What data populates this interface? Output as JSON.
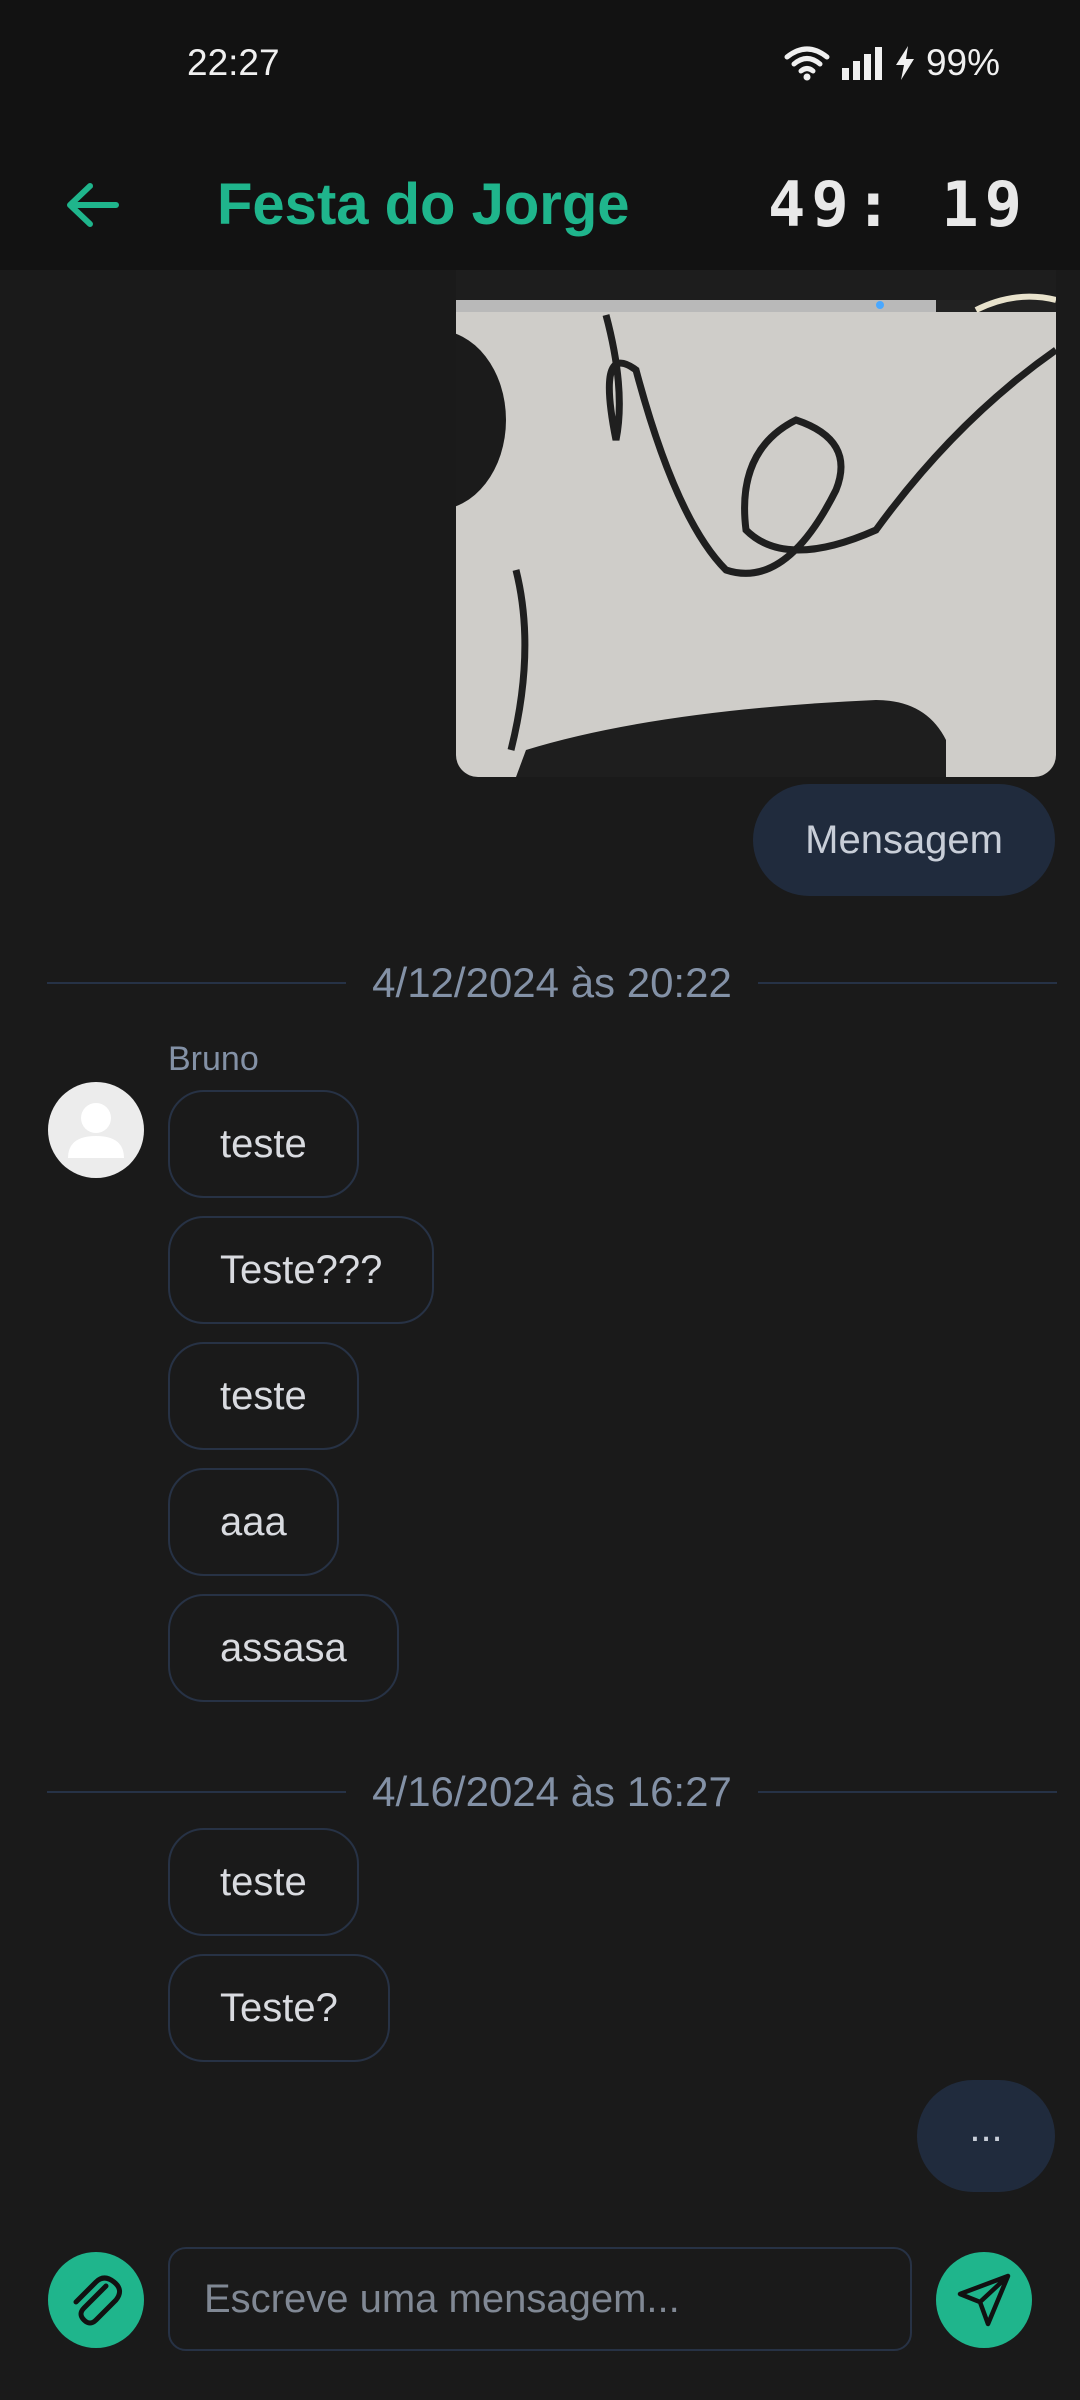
{
  "status_bar": {
    "time": "22:27",
    "battery": "99%"
  },
  "header": {
    "title": "Festa do Jorge",
    "timer": "49: 19",
    "accent_color": "#1fb58c"
  },
  "messages": {
    "own_message": "Mensagem",
    "dividers": [
      "4/12/2024 às 20:22",
      "4/16/2024 às 16:27"
    ],
    "sender": "Bruno",
    "group1": [
      "teste",
      "Teste???",
      "teste",
      "aaa",
      "assasa"
    ],
    "group2": [
      "teste",
      "Teste?"
    ],
    "typing": "..."
  },
  "composer": {
    "placeholder": "Escreve uma mensagem..."
  },
  "icons": [
    "wifi-icon",
    "signal-icon",
    "charging-icon",
    "back-arrow-icon",
    "avatar-placeholder-icon",
    "paperclip-icon",
    "send-icon"
  ]
}
